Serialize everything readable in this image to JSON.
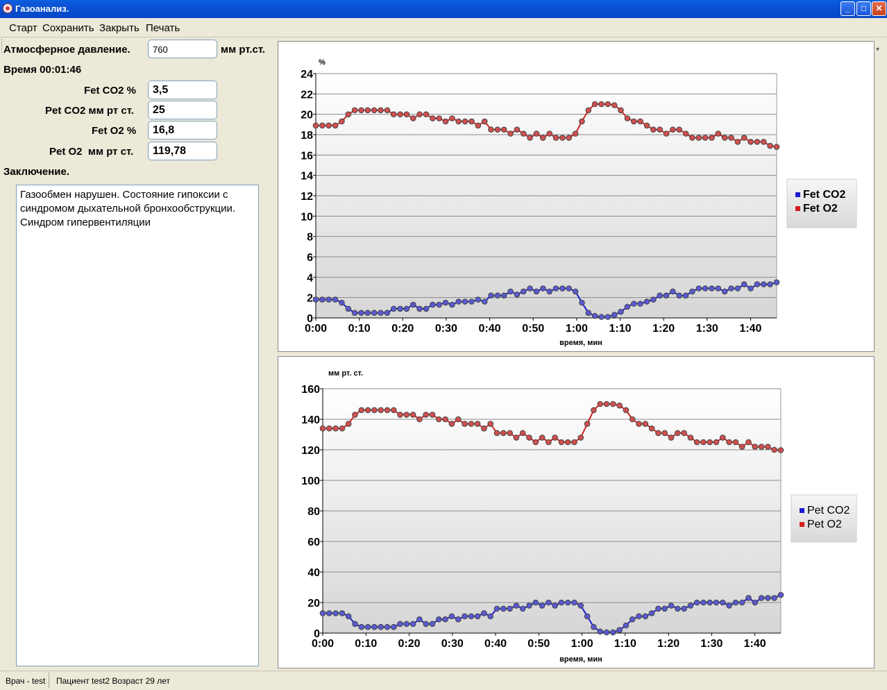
{
  "window": {
    "title": "Газоанализ."
  },
  "menu": [
    "Старт",
    "Сохранить",
    "Закрыть",
    "Печать"
  ],
  "form": {
    "pressure_label": "Атмосферное давление.",
    "pressure_value": "760",
    "pressure_unit": "мм рт.ст.",
    "time_label": "Время 00:01:46",
    "fet_co2_label": "Fet CO2 %",
    "fet_co2_value": "3,5",
    "pet_co2_label": "Pet CO2 мм рт ст.",
    "pet_co2_value": "25",
    "fet_o2_label": "Fet O2 %",
    "fet_o2_value": "16,8",
    "pet_o2_label": "Pet O2  мм рт ст.",
    "pet_o2_value": "119,78",
    "conclusion_label": "Заключение.",
    "conclusion_text": "Газообмен нарушен. Состояние гипоксии с синдромом дыхательной бронхообструкции. Синдром гипервентиляции"
  },
  "status": {
    "doctor": "Врач - test",
    "patient": "Пациент test2 Возраст 29 лет"
  },
  "colors": {
    "co2": "#1a1ad0",
    "o2": "#d41f1f"
  },
  "chart_data": [
    {
      "type": "line",
      "ylabel": "%",
      "xlabel": "время, мин",
      "ylim": [
        0,
        24
      ],
      "yticks": [
        "0",
        "2",
        "4",
        "6",
        "8",
        "10",
        "12",
        "14",
        "16",
        "18",
        "20",
        "22",
        "24"
      ],
      "xticks": [
        "0:00",
        "0:10",
        "0:20",
        "0:30",
        "0:40",
        "0:50",
        "1:00",
        "1:10",
        "1:20",
        "1:30",
        "1:40"
      ],
      "x_seconds": [
        0,
        106
      ],
      "legend_position": "right",
      "series": [
        {
          "name": "Fet CO2",
          "color": "#1a1ad0",
          "values": [
            1.8,
            1.8,
            1.8,
            1.8,
            1.5,
            0.9,
            0.5,
            0.5,
            0.5,
            0.5,
            0.5,
            0.5,
            0.9,
            0.9,
            0.9,
            1.3,
            0.9,
            0.9,
            1.3,
            1.3,
            1.5,
            1.3,
            1.6,
            1.6,
            1.6,
            1.8,
            1.6,
            2.2,
            2.2,
            2.2,
            2.6,
            2.3,
            2.6,
            2.9,
            2.6,
            2.9,
            2.6,
            2.9,
            2.9,
            2.9,
            2.6,
            1.5,
            0.5,
            0.2,
            0.1,
            0.1,
            0.3,
            0.6,
            1.1,
            1.4,
            1.4,
            1.6,
            1.8,
            2.2,
            2.2,
            2.6,
            2.2,
            2.2,
            2.6,
            2.9,
            2.9,
            2.9,
            2.9,
            2.6,
            2.9,
            2.9,
            3.3,
            2.9,
            3.3,
            3.3,
            3.3,
            3.5
          ]
        },
        {
          "name": "Fet O2",
          "color": "#d41f1f",
          "values": [
            18.9,
            18.9,
            18.9,
            18.9,
            19.3,
            20.0,
            20.4,
            20.4,
            20.4,
            20.4,
            20.4,
            20.4,
            20.0,
            20.0,
            20.0,
            19.6,
            20.0,
            20.0,
            19.6,
            19.6,
            19.3,
            19.6,
            19.3,
            19.3,
            19.3,
            18.9,
            19.3,
            18.5,
            18.5,
            18.5,
            18.1,
            18.5,
            18.1,
            17.7,
            18.1,
            17.7,
            18.1,
            17.7,
            17.7,
            17.7,
            18.1,
            19.3,
            20.4,
            21.0,
            21.0,
            21.0,
            20.9,
            20.4,
            19.6,
            19.3,
            19.3,
            18.9,
            18.5,
            18.5,
            18.1,
            18.5,
            18.5,
            18.1,
            17.7,
            17.7,
            17.7,
            17.7,
            18.1,
            17.7,
            17.7,
            17.3,
            17.7,
            17.3,
            17.3,
            17.3,
            16.9,
            16.8
          ]
        }
      ]
    },
    {
      "type": "line",
      "ylabel": "мм рт. ст.",
      "xlabel": "время, мин",
      "ylim": [
        0,
        160
      ],
      "yticks": [
        "0",
        "20",
        "40",
        "60",
        "80",
        "100",
        "120",
        "140",
        "160"
      ],
      "xticks": [
        "0:00",
        "0:10",
        "0:20",
        "0:30",
        "0:40",
        "0:50",
        "1:00",
        "1:10",
        "1:20",
        "1:30",
        "1:40"
      ],
      "x_seconds": [
        0,
        106
      ],
      "legend_position": "right",
      "series": [
        {
          "name": "Pet CO2",
          "color": "#1a1ad0",
          "values": [
            13,
            13,
            13,
            13,
            11,
            6,
            4,
            4,
            4,
            4,
            4,
            4,
            6,
            6,
            6,
            9,
            6,
            6,
            9,
            9,
            11,
            9,
            11,
            11,
            11,
            13,
            11,
            16,
            16,
            16,
            18,
            16,
            18,
            20,
            18,
            20,
            18,
            20,
            20,
            20,
            18,
            11,
            4,
            1,
            0.5,
            0.5,
            2,
            5,
            9,
            11,
            11,
            13,
            16,
            16,
            18,
            16,
            16,
            18,
            20,
            20,
            20,
            20,
            20,
            18,
            20,
            20,
            23,
            20,
            23,
            23,
            23,
            25
          ]
        },
        {
          "name": "Pet O2",
          "color": "#d41f1f",
          "values": [
            134,
            134,
            134,
            134,
            137,
            143,
            146,
            146,
            146,
            146,
            146,
            146,
            143,
            143,
            143,
            140,
            143,
            143,
            140,
            140,
            137,
            140,
            137,
            137,
            137,
            134,
            137,
            131,
            131,
            131,
            128,
            131,
            128,
            125,
            128,
            125,
            128,
            125,
            125,
            125,
            128,
            137,
            146,
            150,
            150,
            150,
            149,
            146,
            140,
            137,
            137,
            134,
            131,
            131,
            128,
            131,
            131,
            128,
            125,
            125,
            125,
            125,
            128,
            125,
            125,
            122,
            125,
            122,
            122,
            122,
            120,
            119.78
          ]
        }
      ]
    }
  ]
}
